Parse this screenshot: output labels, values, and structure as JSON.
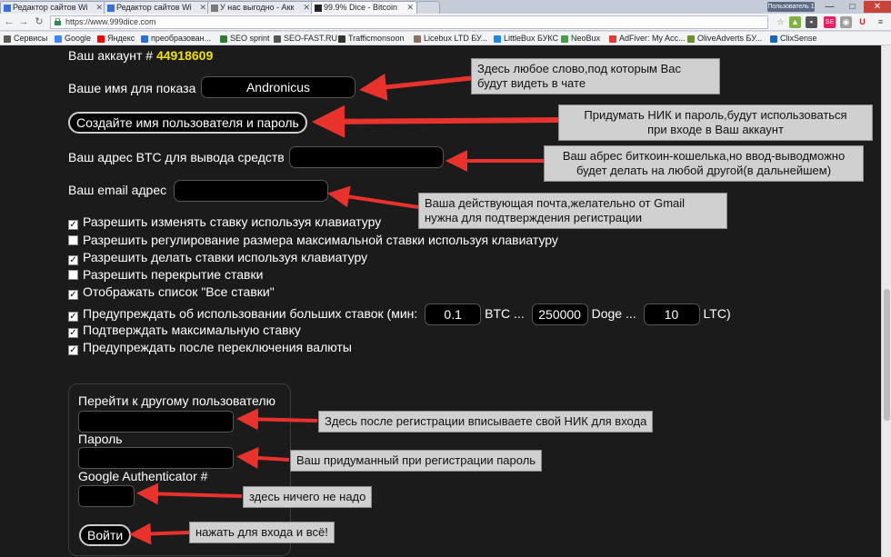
{
  "browser": {
    "tabs": [
      {
        "title": "Редактор сайтов Wi",
        "icon_color": "#3b6fd6"
      },
      {
        "title": "Редактор сайтов Wi",
        "icon_color": "#3b6fd6"
      },
      {
        "title": "У нас выгодно - Акк",
        "icon_color": "#7a7a7a"
      },
      {
        "title": "99.9% Dice - Bitcoin",
        "icon_color": "#222222"
      }
    ],
    "user_badge": "Пользователь 1",
    "window_controls": [
      "—",
      "□",
      "✕"
    ],
    "url": "https://www.999dice.com",
    "bookmarks": [
      {
        "label": "Сервисы",
        "icon_color": "#5a5a5a"
      },
      {
        "label": "Google",
        "icon_color": "#4285f4"
      },
      {
        "label": "Яндекс",
        "icon_color": "#ff0000"
      },
      {
        "label": "преобразован...",
        "icon_color": "#2a6fdb"
      },
      {
        "label": "SEO sprint",
        "icon_color": "#2e7d32"
      },
      {
        "label": "SEO-FAST.RU",
        "icon_color": "#555555"
      },
      {
        "label": "Trafficmonsoon",
        "icon_color": "#333333"
      },
      {
        "label": "Licebux LTD  БУ...",
        "icon_color": "#8d6e63"
      },
      {
        "label": "LittleBux БУКС",
        "icon_color": "#1e88e5"
      },
      {
        "label": "NeoBux",
        "icon_color": "#43a047"
      },
      {
        "label": "AdFiver: My Acc...",
        "icon_color": "#e53935"
      },
      {
        "label": "OliveAdverts БУ...",
        "icon_color": "#6d8f2f"
      },
      {
        "label": "ClixSense",
        "icon_color": "#1565c0"
      }
    ]
  },
  "account": {
    "label": "Ваш аккаунт #",
    "number": "44918609",
    "display_name_label": "Ваше имя для показа",
    "display_name_value": "Andronicus",
    "create_button": "Создайте имя пользователя и пароль",
    "btc_label": "Ваш адрес BTC для вывода средств",
    "btc_value": "",
    "email_label": "Ваш email адрес",
    "email_value": ""
  },
  "options": [
    {
      "label": "Разрешить изменять ставку используя клавиатуру",
      "checked": true
    },
    {
      "label": "Разрешить регулирование размера максимальной ставки используя клавиатуру",
      "checked": false
    },
    {
      "label": "Разрешить делать ставки используя клавиатуру",
      "checked": true
    },
    {
      "label": "Разрешить перекрытие ставки",
      "checked": false
    },
    {
      "label": "Отображать список \"Все ставки\"",
      "checked": true
    },
    {
      "label": "Предупреждать об использовании больших ставок (мин:",
      "checked": true
    },
    {
      "label": "Подтверждать максимальную ставку",
      "checked": true
    },
    {
      "label": "Предупреждать после переключения валюты",
      "checked": true
    }
  ],
  "big_bets": {
    "btc_value": "0.1",
    "btc_label": "BTC ...",
    "doge_value": "250000",
    "doge_label": "Doge ...",
    "ltc_value": "10",
    "ltc_label": "LTC)"
  },
  "login": {
    "switch_user_label": "Перейти к другому пользователю",
    "username_value": "",
    "password_label": "Пароль",
    "password_value": "",
    "ga_label": "Google Authenticator #",
    "ga_value": "",
    "login_button": "Войти"
  },
  "annotations": {
    "name_note": "Здесь любое слово,под которым Вас\nбудут видеть в чате",
    "create_note": "Придумать НИК и пароль,будут использоваться\nпри входе в Ваш аккаунт",
    "btc_note": "Ваш абрес биткоин-кошелька,но ввод-выводможно\nбудет делать на любой другой(в дальнейшем)",
    "email_note": "Ваша действующая почта,желательно от Gmail\nнужна для подтверждения регистрации",
    "username_note": "Здесь после регистрации вписываете свой НИК для входа",
    "password_note": "Ваш придуманный при регистрации пароль",
    "ga_note": "здесь ничего не надо",
    "login_note": "нажать для входа и всё!",
    "arrow_color": "#e8322b"
  }
}
